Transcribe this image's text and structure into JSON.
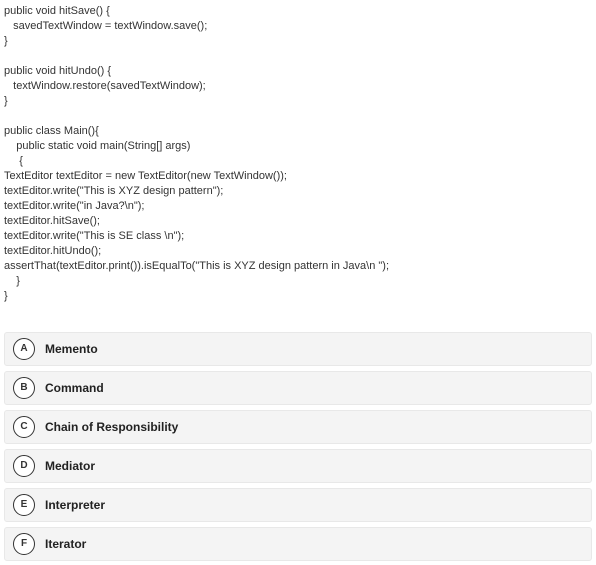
{
  "code": "public void hitSave() {\n   savedTextWindow = textWindow.save();\n}\n\npublic void hitUndo() {\n   textWindow.restore(savedTextWindow);\n}\n\npublic class Main(){\n    public static void main(String[] args)\n     {\nTextEditor textEditor = new TextEditor(new TextWindow());\ntextEditor.write(\"This is XYZ design pattern\");\ntextEditor.write(\"in Java?\\n\");\ntextEditor.hitSave();\ntextEditor.write(\"This is SE class \\n\");\ntextEditor.hitUndo();\nassertThat(textEditor.print()).isEqualTo(\"This is XYZ design pattern in Java\\n \");\n    }\n}",
  "answers": [
    {
      "letter": "A",
      "label": "Memento"
    },
    {
      "letter": "B",
      "label": "Command"
    },
    {
      "letter": "C",
      "label": "Chain of Responsibility"
    },
    {
      "letter": "D",
      "label": "Mediator"
    },
    {
      "letter": "E",
      "label": "Interpreter"
    },
    {
      "letter": "F",
      "label": "Iterator"
    }
  ]
}
